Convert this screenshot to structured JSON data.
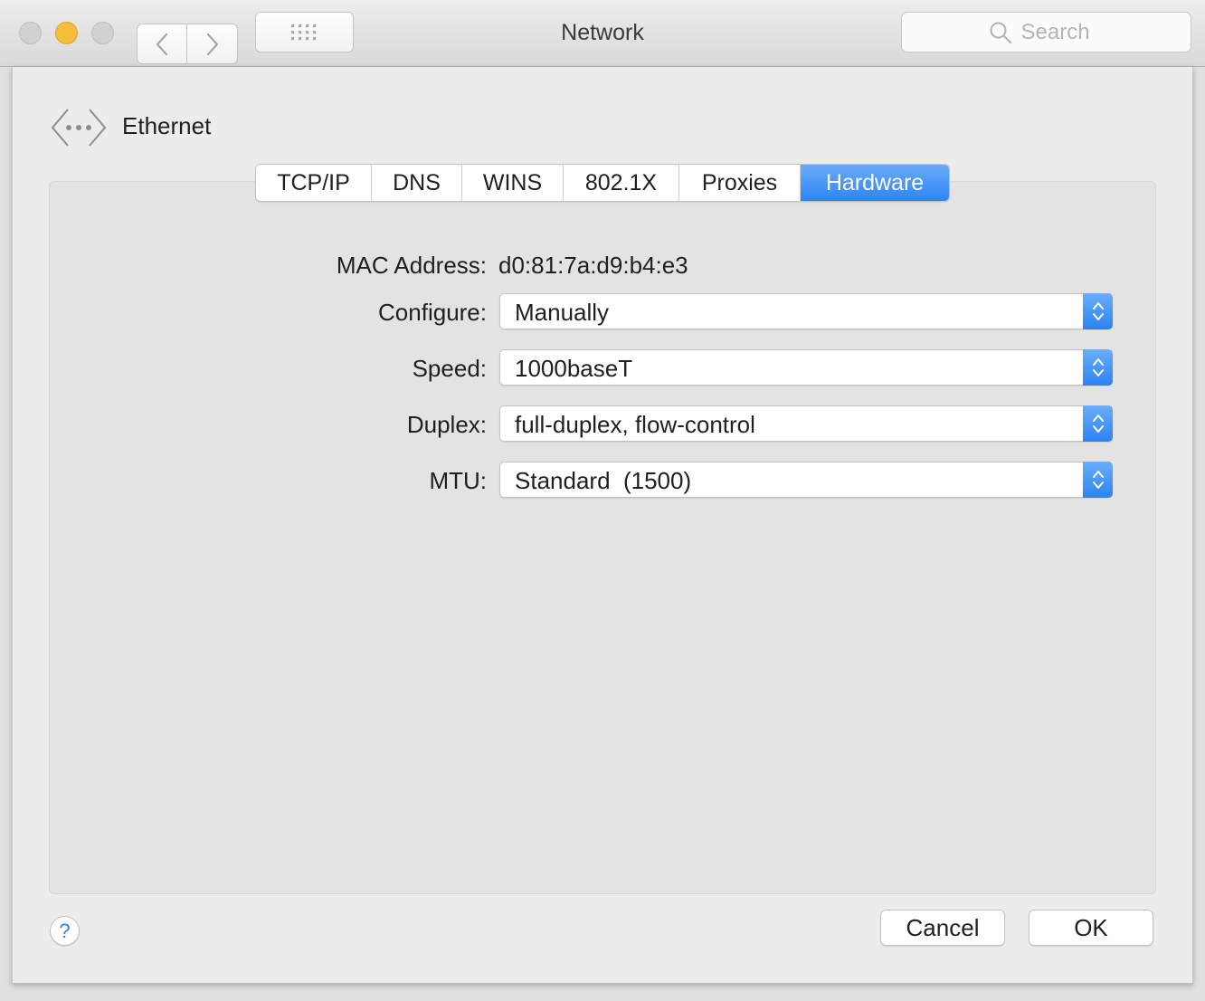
{
  "window": {
    "title": "Network"
  },
  "toolbar": {
    "traffic_lights": [
      "close",
      "minimize",
      "zoom"
    ],
    "back_icon": "chevron-left-icon",
    "forward_icon": "chevron-right-icon",
    "grid_icon": "show-all-grid-icon",
    "search_placeholder": "Search"
  },
  "interface": {
    "name": "Ethernet",
    "icon": "ethernet-icon"
  },
  "tabs": [
    {
      "label": "TCP/IP",
      "active": false
    },
    {
      "label": "DNS",
      "active": false
    },
    {
      "label": "WINS",
      "active": false
    },
    {
      "label": "802.1X",
      "active": false
    },
    {
      "label": "Proxies",
      "active": false
    },
    {
      "label": "Hardware",
      "active": true
    }
  ],
  "hardware": {
    "mac_label": "MAC Address:",
    "mac_value": "d0:81:7a:d9:b4:e3",
    "configure_label": "Configure:",
    "configure_value": "Manually",
    "speed_label": "Speed:",
    "speed_value": "1000baseT",
    "duplex_label": "Duplex:",
    "duplex_value": "full-duplex, flow-control",
    "mtu_label": "MTU:",
    "mtu_value": "Standard  (1500)"
  },
  "footer": {
    "help_label": "?",
    "cancel_label": "Cancel",
    "ok_label": "OK"
  },
  "colors": {
    "accent": "#2e84f4",
    "minimize": "#f5bd3a",
    "inactive_light": "#d1d1d1"
  }
}
